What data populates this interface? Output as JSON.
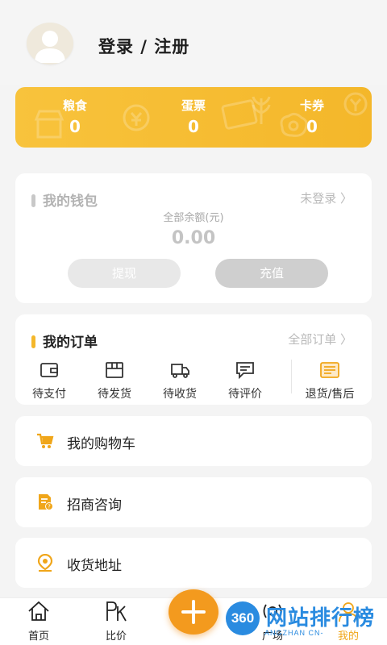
{
  "header": {
    "login_title": "登录 / 注册"
  },
  "stats": [
    {
      "label": "粮食",
      "value": "0"
    },
    {
      "label": "蛋票",
      "value": "0"
    },
    {
      "label": "卡券",
      "value": "0"
    }
  ],
  "wallet": {
    "title": "我的钱包",
    "status": "未登录 〉",
    "balance_label": "全部余额(元)",
    "balance_value": "0.00",
    "withdraw_label": "提现",
    "recharge_label": "充值"
  },
  "orders": {
    "title": "我的订单",
    "all_link": "全部订单 〉",
    "items": [
      {
        "label": "待支付",
        "icon": "wallet-icon"
      },
      {
        "label": "待发货",
        "icon": "box-icon"
      },
      {
        "label": "待收货",
        "icon": "truck-icon"
      },
      {
        "label": "待评价",
        "icon": "comment-icon"
      },
      {
        "label": "退货/售后",
        "icon": "refund-icon"
      }
    ]
  },
  "menu": [
    {
      "label": "我的购物车",
      "icon": "cart-icon"
    },
    {
      "label": "招商咨询",
      "icon": "document-icon"
    },
    {
      "label": "收货地址",
      "icon": "location-icon"
    }
  ],
  "tabbar": [
    {
      "label": "首页",
      "icon": "home-icon"
    },
    {
      "label": "比价",
      "icon": "pk-icon"
    },
    {
      "label": "广场",
      "icon": "broadcast-icon"
    },
    {
      "label": "我的",
      "icon": "user-icon",
      "active": true
    }
  ],
  "watermark": {
    "logo": "360",
    "text": "网站排行榜",
    "sub": "ANGZHAN CN-"
  },
  "colors": {
    "accent": "#f4b72a",
    "orange": "#f39a1e",
    "active_tab": "#f0a61a",
    "watermark": "#2a8be0"
  }
}
